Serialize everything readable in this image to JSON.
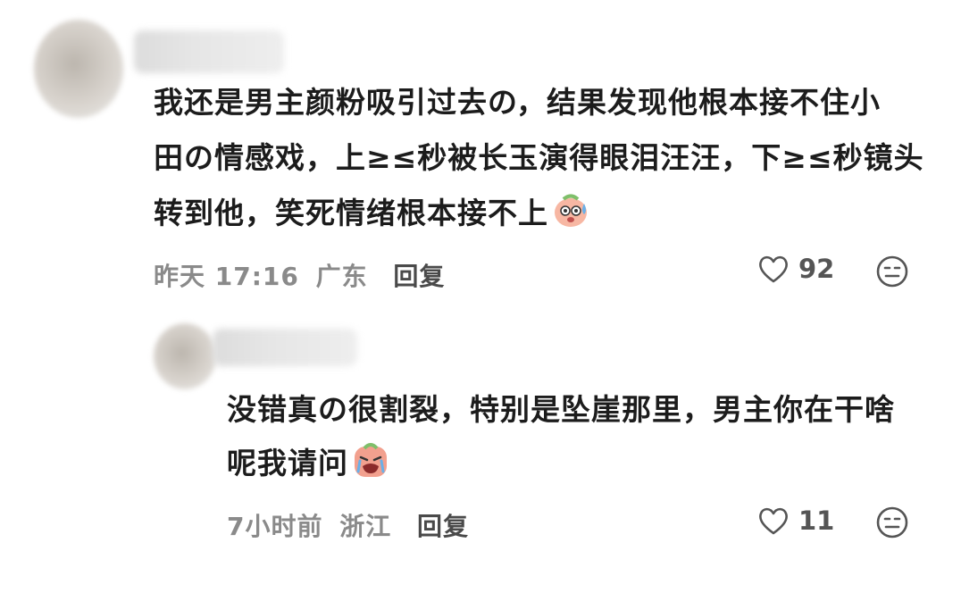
{
  "comments": [
    {
      "lines": [
        "我还是男主颜粉吸引过去の，结果发现他根本接不住小",
        "田の情感戏，上≥≤秒被长玉演得眼泪汪汪，下≥≤秒镜头",
        "转到他，笑死情绪根本接不上"
      ],
      "emoji": "sweat-face-emoji",
      "time": "昨天 17:16",
      "location": "广东",
      "reply_label": "回复",
      "likes": "92",
      "like_icon": "heart-outline-icon",
      "react_icon": "neutral-face-icon"
    },
    {
      "lines": [
        "没错真の很割裂，特别是坠崖那里，男主你在干啥",
        "呢我请问"
      ],
      "emoji": "crying-face-emoji",
      "time": "7小时前",
      "location": "浙江",
      "reply_label": "回复",
      "likes": "11",
      "like_icon": "heart-outline-icon",
      "react_icon": "neutral-face-icon"
    }
  ],
  "colors": {
    "text": "#1c1c1c",
    "meta": "#8a8a8a",
    "icon": "#555555"
  }
}
